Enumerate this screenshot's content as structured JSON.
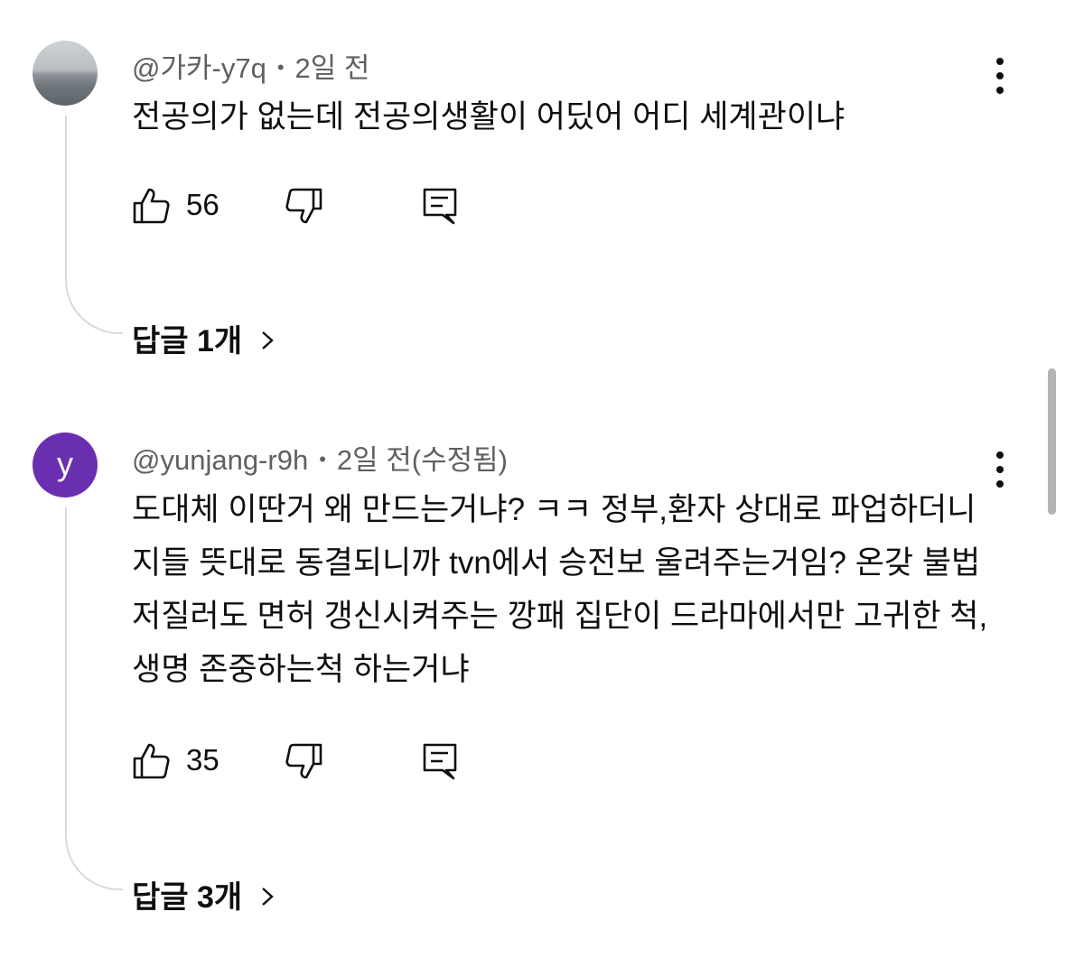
{
  "comments": [
    {
      "author": "@가카-y7q",
      "separator": "•",
      "time": "2일 전",
      "text": "전공의가 없는데 전공의생활이 어딨어 어디 세계관이냐",
      "likes": "56",
      "replies_label": "답글 1개",
      "avatar_type": "photo"
    },
    {
      "author": "@yunjang-r9h",
      "separator": "•",
      "time": "2일 전(수정됨)",
      "text": "도대체 이딴거 왜 만드는거냐? ㅋㅋ 정부,환자 상대로 파업하더니 지들 뜻대로 동결되니까 tvn에서 승전보 울려주는거임? 온갖 불법 저질러도 면허 갱신시켜주는 깡패 집단이 드라마에서만 고귀한 척, 생명 존중하는척 하는거냐",
      "likes": "35",
      "replies_label": "답글 3개",
      "avatar_letter": "y",
      "avatar_color": "#6a2fb0"
    }
  ],
  "icons": {
    "like": "thumb-up-icon",
    "dislike": "thumb-down-icon",
    "reply": "comment-reply-icon",
    "more": "more-vert-icon",
    "chevron": "chevron-right-icon"
  }
}
